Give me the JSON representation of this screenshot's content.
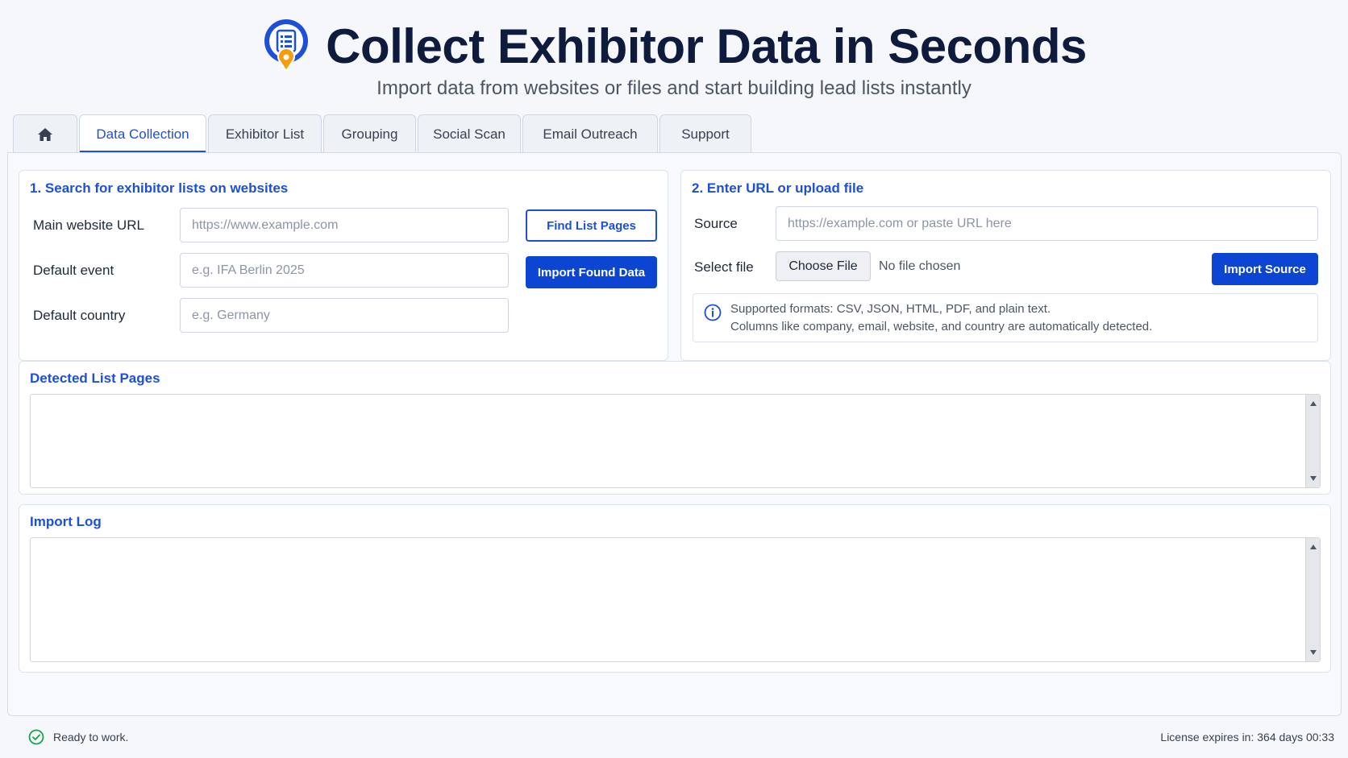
{
  "hero": {
    "title": "Collect Exhibitor Data in Seconds",
    "subtitle": "Import data from websites or files and start building lead lists instantly",
    "logo_icon": "list-location-pin-icon"
  },
  "tabs": [
    {
      "label": "",
      "icon": "home-icon",
      "active": false
    },
    {
      "label": "Data Collection",
      "active": true
    },
    {
      "label": "Exhibitor List",
      "active": false
    },
    {
      "label": "Grouping",
      "active": false
    },
    {
      "label": "Social Scan",
      "active": false
    },
    {
      "label": "Email Outreach",
      "active": false
    },
    {
      "label": "Support",
      "active": false
    }
  ],
  "search_panel": {
    "title": "1. Search for exhibitor lists on websites",
    "main_url_label": "Main website URL",
    "main_url_placeholder": "https://www.example.com",
    "main_url_value": "",
    "default_event_label": "Default event",
    "default_event_placeholder": "e.g. IFA Berlin 2025",
    "default_event_value": "",
    "default_country_label": "Default country",
    "default_country_placeholder": "e.g. Germany",
    "default_country_value": "",
    "find_button": "Find List Pages",
    "import_button": "Import Found Data"
  },
  "source_panel": {
    "title": "2. Enter URL or upload file",
    "source_label": "Source",
    "source_placeholder": "https://example.com or paste URL here",
    "source_value": "",
    "select_file_label": "Select file",
    "choose_file_button": "Choose File",
    "file_status": "No file chosen",
    "import_button": "Import Source",
    "info_line1": "Supported formats: CSV, JSON, HTML, PDF, and plain text.",
    "info_line2": "Columns like company, email, website, and country are automatically detected."
  },
  "detected_panel": {
    "title": "Detected List Pages",
    "items": []
  },
  "log_panel": {
    "title": "Import Log",
    "entries": []
  },
  "statusbar": {
    "status": "Ready to work.",
    "license": "License expires in: 364 days 00:33"
  },
  "colors": {
    "accent": "#1d4fd8",
    "primary_button": "#0b45d1",
    "title": "#0f1b3d",
    "status_ok": "#16a34a",
    "logo_pin": "#f59e0b"
  }
}
